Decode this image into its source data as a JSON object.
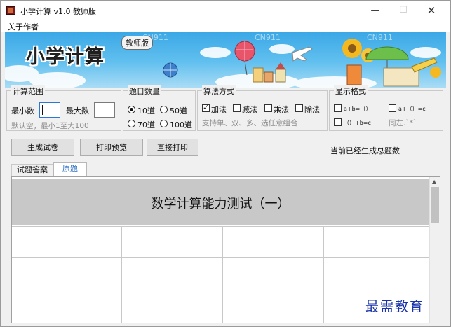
{
  "window": {
    "title": "小学计算 v1.0 教师版",
    "minimize": "—",
    "maximize": "☐",
    "close": "✕"
  },
  "menu": {
    "about": "关于作者"
  },
  "banner": {
    "logo": "小学计算",
    "badge": "教师版",
    "watermark_text": "CN911"
  },
  "range": {
    "label": "计算范围",
    "min_label": "最小数",
    "max_label": "最大数",
    "min_value": "",
    "max_value": "",
    "hint": "默认空，最小1至大100"
  },
  "count": {
    "label": "题目数量",
    "options": [
      "10道",
      "50道",
      "70道",
      "100道"
    ],
    "selected": "10道"
  },
  "ops": {
    "label": "算法方式",
    "options": [
      "加法",
      "减法",
      "乘法",
      "除法"
    ],
    "checked": [
      "加法"
    ],
    "hint": "支持单、双、多、选任意组合"
  },
  "format": {
    "label": "显示格式",
    "options": [
      "a+b=（）",
      "a+（）=c",
      "（）+b=c",
      "同左.`*`"
    ]
  },
  "actions": {
    "generate": "生成试卷",
    "preview": "打印预览",
    "print": "直接打印",
    "status": "当前已经生成总题数"
  },
  "tabs": [
    "试题答案",
    "原题"
  ],
  "active_tab": "原题",
  "paper": {
    "title": "数学计算能力测试（一）"
  },
  "corner_watermark": "最需教育"
}
